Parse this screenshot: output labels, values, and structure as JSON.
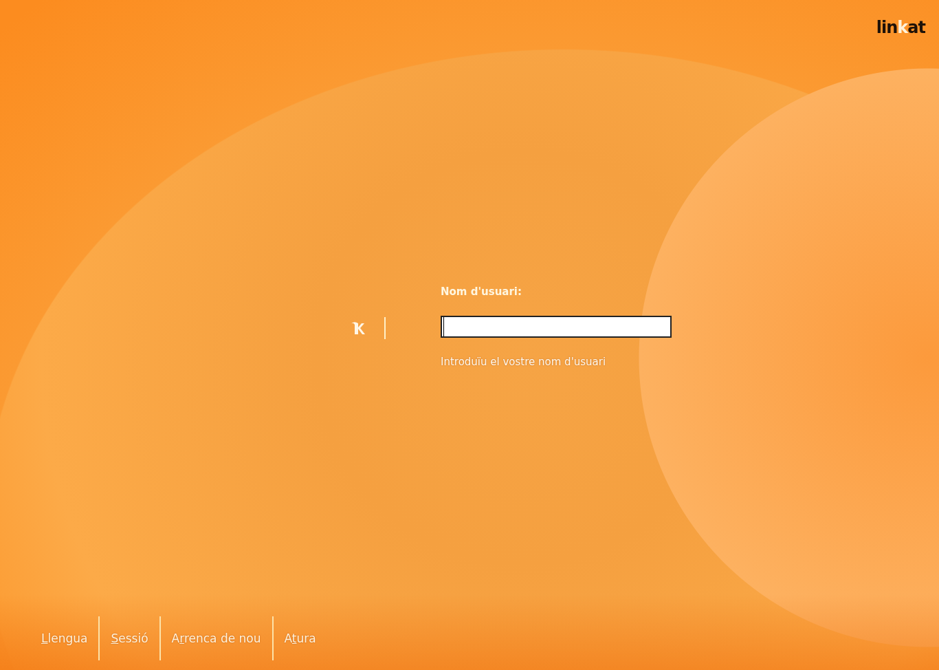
{
  "logo": {
    "before": "lin",
    "accent": "k",
    "after": "at"
  },
  "login": {
    "label": "Nom d'usuari:",
    "input": {
      "focused": true
    },
    "hint": "Introduïu el vostre nom d'usuari"
  },
  "actions": [
    {
      "key": "L",
      "after": "lengua"
    },
    {
      "key": "S",
      "after": "essió"
    },
    {
      "before": "A",
      "key": "r",
      "after": "renca de nou"
    },
    {
      "before": "A",
      "key": "t",
      "after": "ura"
    }
  ]
}
